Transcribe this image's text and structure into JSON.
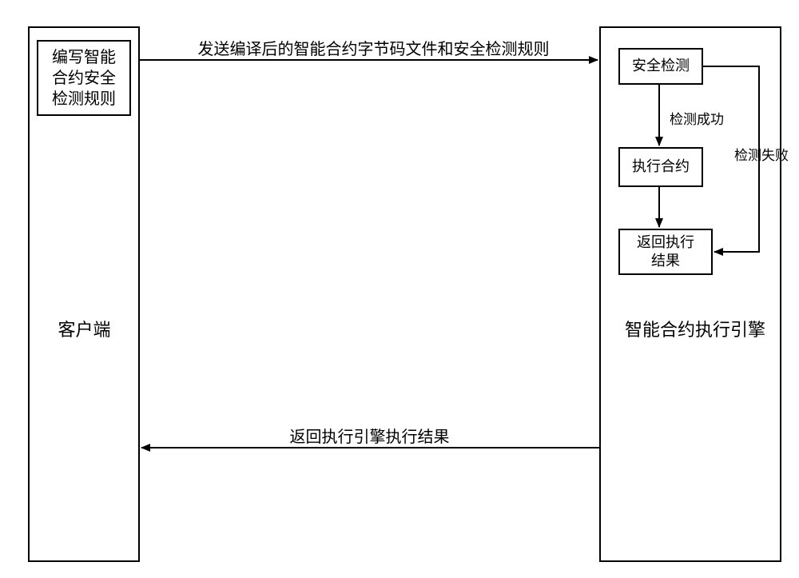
{
  "client": {
    "title": "客户端",
    "rule_box": "编写智能\n合约安全\n检测规则"
  },
  "engine": {
    "title": "智能合约执行引擎",
    "security_check": "安全检测",
    "check_success": "检测成功",
    "check_fail": "检测失败",
    "execute_contract": "执行合约",
    "return_result": "返回执行\n结果"
  },
  "arrows": {
    "send_rules": "发送编译后的智能合约字节码文件和安全检测规则",
    "return_engine_result": "返回执行引擎执行结果"
  }
}
